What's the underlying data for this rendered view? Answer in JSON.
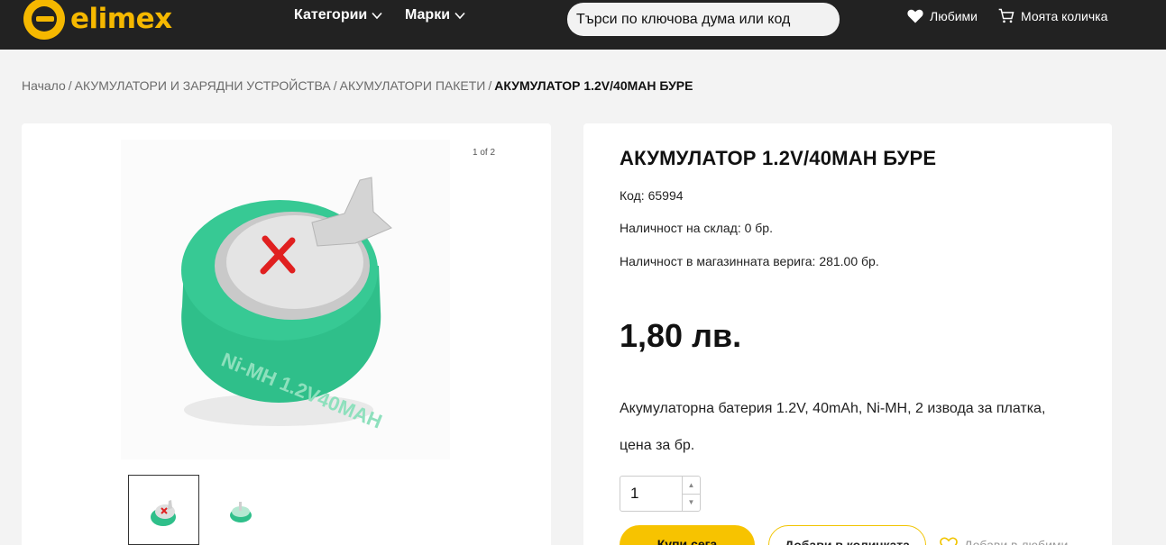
{
  "header": {
    "logo_text": "elimex",
    "nav": [
      {
        "label": "Категории",
        "icon": "chevron-down-icon"
      },
      {
        "label": "Марки",
        "icon": "chevron-down-icon"
      }
    ],
    "search_placeholder": "Търси по ключова дума или код",
    "favorites_label": "Любими",
    "cart_label": "Моята количка",
    "colors": {
      "background": "#222222",
      "accent": "#f5b800",
      "text": "#ffffff"
    }
  },
  "breadcrumb": {
    "items": [
      "Начало",
      "АКУМУЛАТОРИ И ЗАРЯДНИ УСТРОЙСТВА",
      "АКУМУЛАТОРИ ПАКЕТИ"
    ],
    "current": "АКУМУЛАТОР 1.2V/40MAH БУРЕ",
    "separator": "/"
  },
  "gallery": {
    "counter": "1 of 2",
    "image_alt": "Green Ni-MH 1.2V 40mAh button cell with tab"
  },
  "product": {
    "title": "АКУМУЛАТОР 1.2V/40MAH БУРЕ",
    "code": "Код: 65994",
    "stock_warehouse": "Наличност на склад: 0 бр.",
    "stock_chain": "Наличност в магазинната верига: 281.00 бр.",
    "price": "1,80 лв.",
    "description_line1": "Акумулаторна батерия 1.2V, 40mAh, Ni-MH, 2 извода за платка,",
    "description_line2": "цена за бр.",
    "quantity": "1",
    "buy_now_label": "Купи сега",
    "add_to_cart_label": "Добави в количката",
    "add_favorite_label": "Добави в любими",
    "colors": {
      "buy_button": "#f7c300"
    }
  }
}
